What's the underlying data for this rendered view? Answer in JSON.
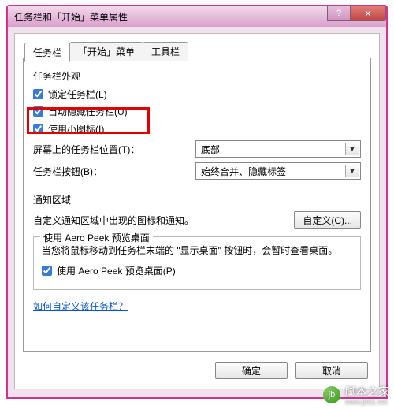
{
  "window": {
    "title": "任务栏和「开始」菜单属性"
  },
  "tabs": {
    "items": [
      "任务栏",
      "「开始」菜单",
      "工具栏"
    ],
    "active_index": 0
  },
  "appearance": {
    "header": "任务栏外观",
    "lock": "锁定任务栏(L)",
    "autohide": "自动隐藏任务栏(U)",
    "smallicons": "使用小图标(I)",
    "position_label": "屏幕上的任务栏位置(T)：",
    "position_value": "底部",
    "buttons_label": "任务栏按钮(B)：",
    "buttons_value": "始终合并、隐藏标签"
  },
  "notify": {
    "header": "通知区域",
    "desc": "自定义通知区域中出现的图标和通知。",
    "customize_btn": "自定义(C)..."
  },
  "aero": {
    "legend": "使用 Aero Peek 预览桌面",
    "desc": "当您将鼠标移动到任务栏末端的 \"显示桌面\" 按钮时，会暂时查看桌面。",
    "checkbox": "使用 Aero Peek 预览桌面(P)"
  },
  "link": "如何自定义该任务栏？",
  "buttons": {
    "ok": "确定",
    "cancel": "取消"
  },
  "checked": {
    "lock": true,
    "autohide": true,
    "smallicons": true,
    "aero": true
  },
  "watermark": {
    "site": "脚本之家",
    "url": "www.jb51.net"
  }
}
